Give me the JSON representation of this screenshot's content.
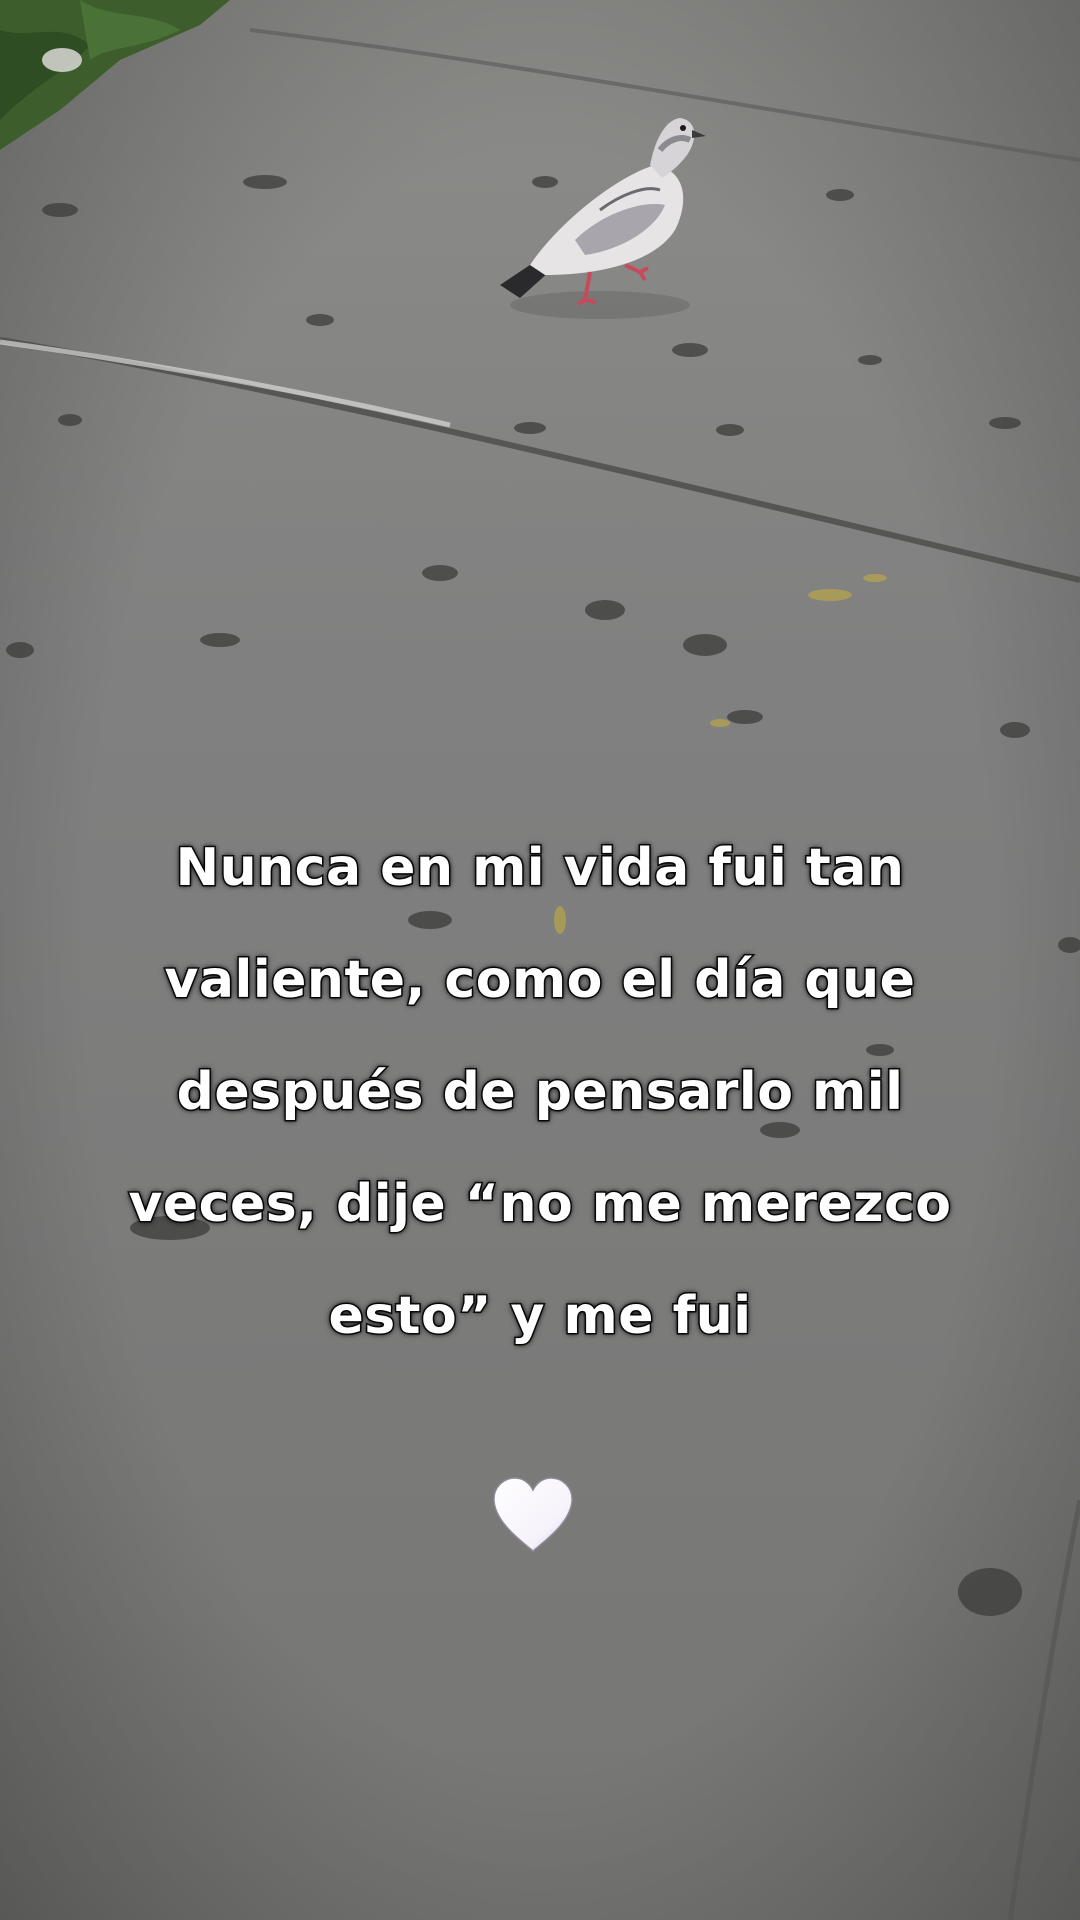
{
  "caption": {
    "lines": [
      "Nunca en mi vida fui tan",
      "valiente, como el día que",
      "después de pensarlo mil",
      "veces, dije “no me merezco",
      "esto” y me fui"
    ]
  },
  "decorations": {
    "heart_icon": "white-heart-icon",
    "heart_color": "#ffffff",
    "heart_tint": "#c9b8e8"
  },
  "scene": {
    "background_color": "#7a7a77",
    "subject": "pigeon-on-sidewalk"
  }
}
